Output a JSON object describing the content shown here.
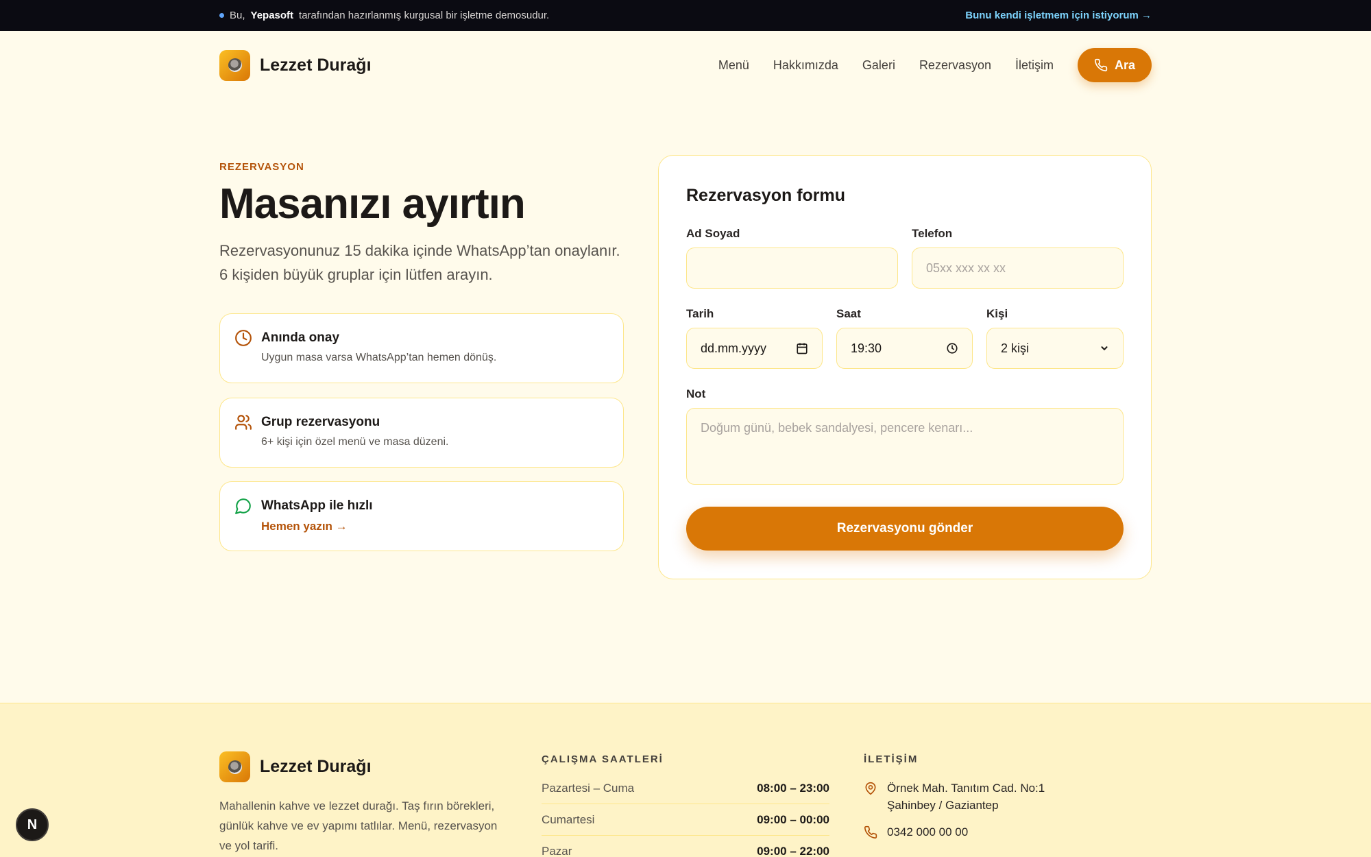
{
  "banner": {
    "prefix": "Bu,",
    "brand": "Yepasoft",
    "suffix": "tarafından hazırlanmış kurgusal bir işletme demosudur.",
    "cta": "Bunu kendi işletmem için istiyorum →"
  },
  "header": {
    "logo_text": "Lezzet Durağı",
    "nav": [
      "Menü",
      "Hakkımızda",
      "Galeri",
      "Rezervasyon",
      "İletişim"
    ],
    "call_label": "Ara"
  },
  "hero": {
    "eyebrow": "REZERVASYON",
    "title": "Masanızı ayırtın",
    "subtitle": "Rezervasyonunuz 15 dakika içinde WhatsApp’tan onaylanır. 6 kişiden büyük gruplar için lütfen arayın."
  },
  "features": [
    {
      "title": "Anında onay",
      "desc": "Uygun masa varsa WhatsApp’tan hemen dönüş.",
      "icon": "clock-icon"
    },
    {
      "title": "Grup rezervasyonu",
      "desc": "6+ kişi için özel menü ve masa düzeni.",
      "icon": "users-icon"
    },
    {
      "title": "WhatsApp ile hızlı",
      "link": "Hemen yazın →",
      "icon": "chat-bubble-icon"
    }
  ],
  "form": {
    "title": "Rezervasyon formu",
    "name_label": "Ad Soyad",
    "name_value": "",
    "phone_label": "Telefon",
    "phone_placeholder": "05xx xxx xx xx",
    "date_label": "Tarih",
    "date_value": "dd.mm.yyyy",
    "time_label": "Saat",
    "time_value": "19:30",
    "people_label": "Kişi",
    "people_value": "2 kişi",
    "note_label": "Not",
    "note_placeholder": "Doğum günü, bebek sandalyesi, pencere kenarı...",
    "submit": "Rezervasyonu gönder"
  },
  "footer": {
    "logo_text": "Lezzet Durağı",
    "desc": "Mahallenin kahve ve lezzet durağı. Taş fırın börekleri, günlük kahve ve ev yapımı tatlılar. Menü, rezervasyon ve yol tarifi.",
    "hours_title": "ÇALIŞMA SAATLERİ",
    "hours": [
      {
        "day": "Pazartesi – Cuma",
        "time": "08:00 – 23:00"
      },
      {
        "day": "Cumartesi",
        "time": "09:00 – 00:00"
      },
      {
        "day": "Pazar",
        "time": "09:00 – 22:00"
      }
    ],
    "contact_title": "İLETİŞİM",
    "address_line1": "Örnek Mah. Tanıtım Cad. No:1",
    "address_line2": "Şahinbey / Gaziantep",
    "phone": "0342 000 00 00"
  },
  "colors": {
    "accent": "#d97706",
    "background": "#fffbeb",
    "border": "#fde68a",
    "topbar": "#0b0b12"
  }
}
